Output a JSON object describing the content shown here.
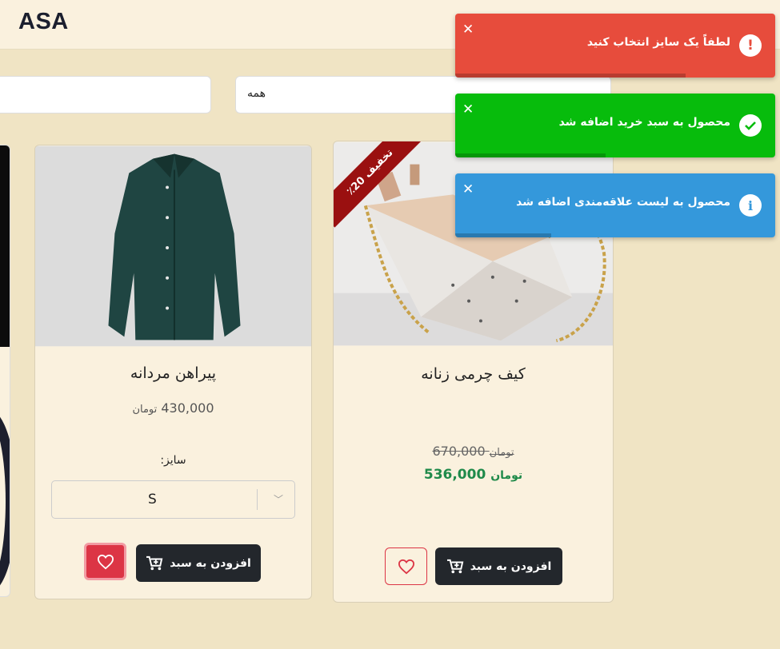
{
  "header": {
    "logo": "ASA"
  },
  "filters": {
    "search_placeholder": "",
    "category_value": "همه"
  },
  "products": [
    {
      "title": "پیراهن مردانه",
      "currency": "تومان",
      "price": "430,000",
      "size_label": "سایز:",
      "size_value": "S",
      "cart_label": "افزودن به سبد",
      "wishlisted": true
    },
    {
      "title": "کیف چرمی زنانه",
      "currency": "تومان",
      "old_price": "670,000",
      "new_price": "536,000",
      "discount_badge": "تخفیف 20٪",
      "cart_label": "افزودن به سبد",
      "wishlisted": false
    }
  ],
  "toasts": [
    {
      "type": "error",
      "icon": "exclamation-icon",
      "color": "#e74c3c",
      "message": "لطفاً یک سایز انتخاب کنید",
      "progress": 0.72
    },
    {
      "type": "success",
      "icon": "check-icon",
      "color": "#07bc0c",
      "message": "محصول به سبد خرید اضافه شد",
      "progress": 0.47
    },
    {
      "type": "info",
      "icon": "info-icon",
      "color": "#3498db",
      "message": "محصول به لیست علاقه‌مندی اضافه شد",
      "progress": 0.3
    }
  ],
  "colors": {
    "background": "#f0e4c4",
    "card": "#faf1de",
    "button": "#23272c",
    "heart": "#dc3545",
    "sale_price": "#1f8a4a"
  }
}
